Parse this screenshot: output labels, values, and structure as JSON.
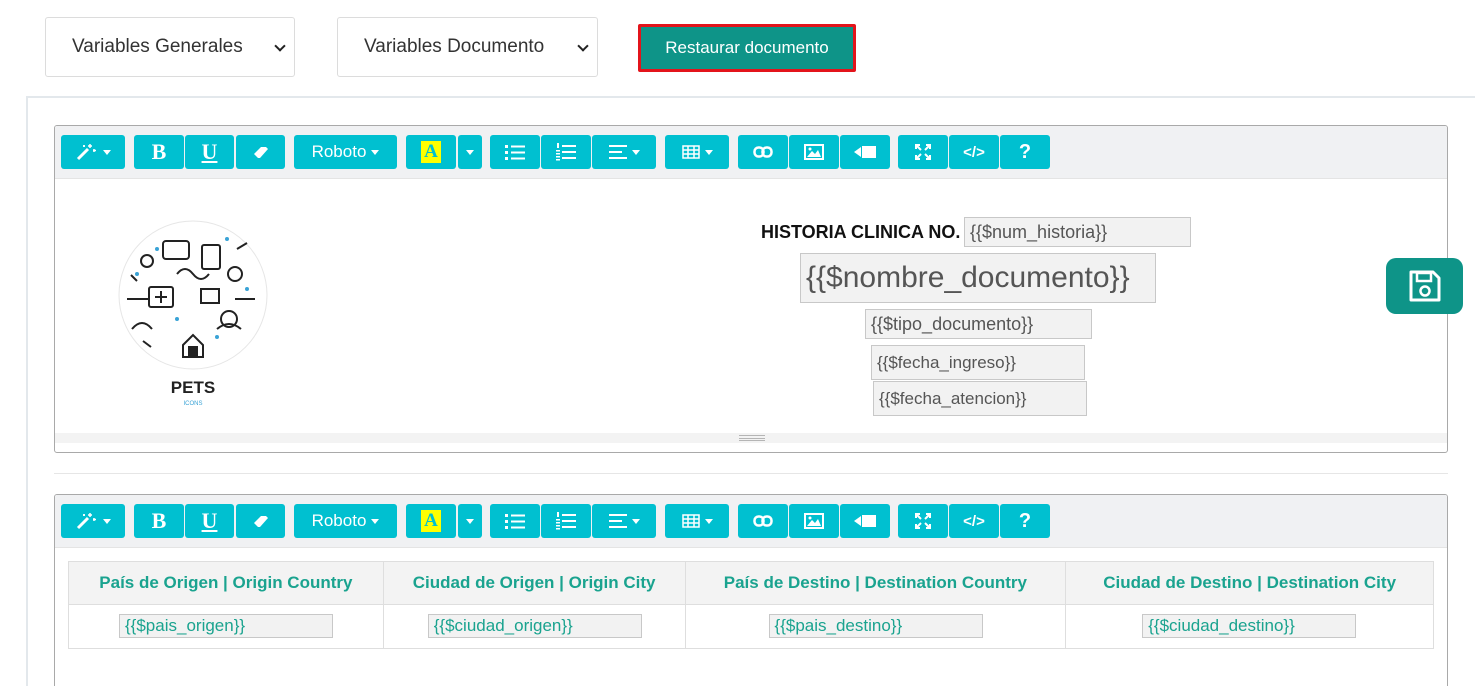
{
  "top": {
    "select_general": "Variables Generales",
    "select_document": "Variables Documento",
    "restore_button": "Restaurar documento"
  },
  "toolbar": {
    "font_name": "Roboto",
    "highlight_letter": "A",
    "help": "?",
    "code": "</>"
  },
  "header": {
    "history_label": "HISTORIA CLINICA NO.",
    "num_historia": "{{$num_historia}}",
    "nombre_documento": "{{$nombre_documento}}",
    "tipo_documento": "{{$tipo_documento}}",
    "fecha_ingreso": "{{$fecha_ingreso}}",
    "fecha_atencion": "{{$fecha_atencion}}",
    "logo_text": "PETS",
    "logo_subtext": "ICONS"
  },
  "table": {
    "headers": [
      "País de Origen | Origin Country",
      "Ciudad de Origen | Origin City",
      "País de Destino | Destination Country",
      "Ciudad de Destino | Destination City"
    ],
    "values": [
      "{{$pais_origen}}",
      "{{$ciudad_origen}}",
      "{{$pais_destino}}",
      "{{$ciudad_destino}}"
    ]
  },
  "colors": {
    "toolbar_button": "#00c0d0",
    "primary": "#0e9488",
    "highlight_border": "#e3141b",
    "table_text": "#1aa38f"
  }
}
